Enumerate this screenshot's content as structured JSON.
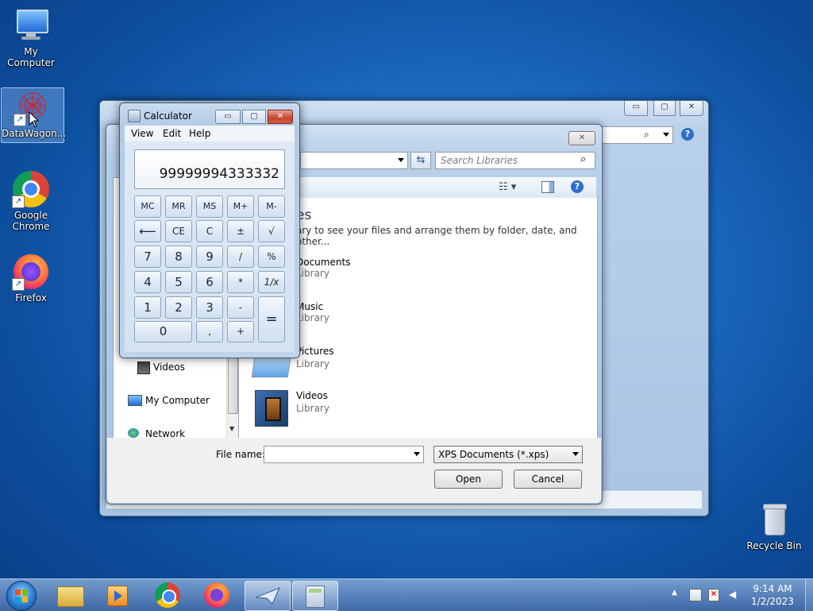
{
  "desktop": {
    "icons": [
      {
        "label": "My Computer"
      },
      {
        "label": "DataWagon..."
      },
      {
        "label": "Google Chrome"
      },
      {
        "label": "Firefox"
      },
      {
        "label": "Recycle Bin"
      }
    ]
  },
  "open_dialog": {
    "search_placeholder": "Search Libraries",
    "heading_partial": "es",
    "description_partial": "ary to see your files and arrange them by folder, date, and other...",
    "libraries": [
      {
        "name": "Documents",
        "sub": "Library"
      },
      {
        "name": "Music",
        "sub": "Library"
      },
      {
        "name": "Pictures",
        "sub": "Library"
      },
      {
        "name": "Videos",
        "sub": "Library"
      }
    ],
    "nav": {
      "videos": "Videos",
      "my_computer": "My Computer",
      "network": "Network"
    },
    "file_name_label": "File name:",
    "file_name_value": "",
    "file_type": "XPS Documents (*.xps)",
    "open_label": "Open",
    "cancel_label": "Cancel"
  },
  "calculator": {
    "title": "Calculator",
    "menu": [
      "View",
      "Edit",
      "Help"
    ],
    "display": "99999994333332",
    "keys": {
      "mc": "MC",
      "mr": "MR",
      "ms": "MS",
      "mplus": "M+",
      "mminus": "M-",
      "back": "⟵",
      "ce": "CE",
      "c": "C",
      "pm": "±",
      "sqrt": "√",
      "n7": "7",
      "n8": "8",
      "n9": "9",
      "div": "/",
      "pct": "%",
      "n4": "4",
      "n5": "5",
      "n6": "6",
      "mul": "*",
      "recip": "1/x",
      "n1": "1",
      "n2": "2",
      "n3": "3",
      "sub": "-",
      "eq": "=",
      "n0": "0",
      "dot": ".",
      "add": "+"
    }
  },
  "taskbar": {
    "time": "9:14 AM",
    "date": "1/2/2023"
  },
  "colors": {
    "accent": "#1e6cc2",
    "close_red": "#c7432c"
  }
}
